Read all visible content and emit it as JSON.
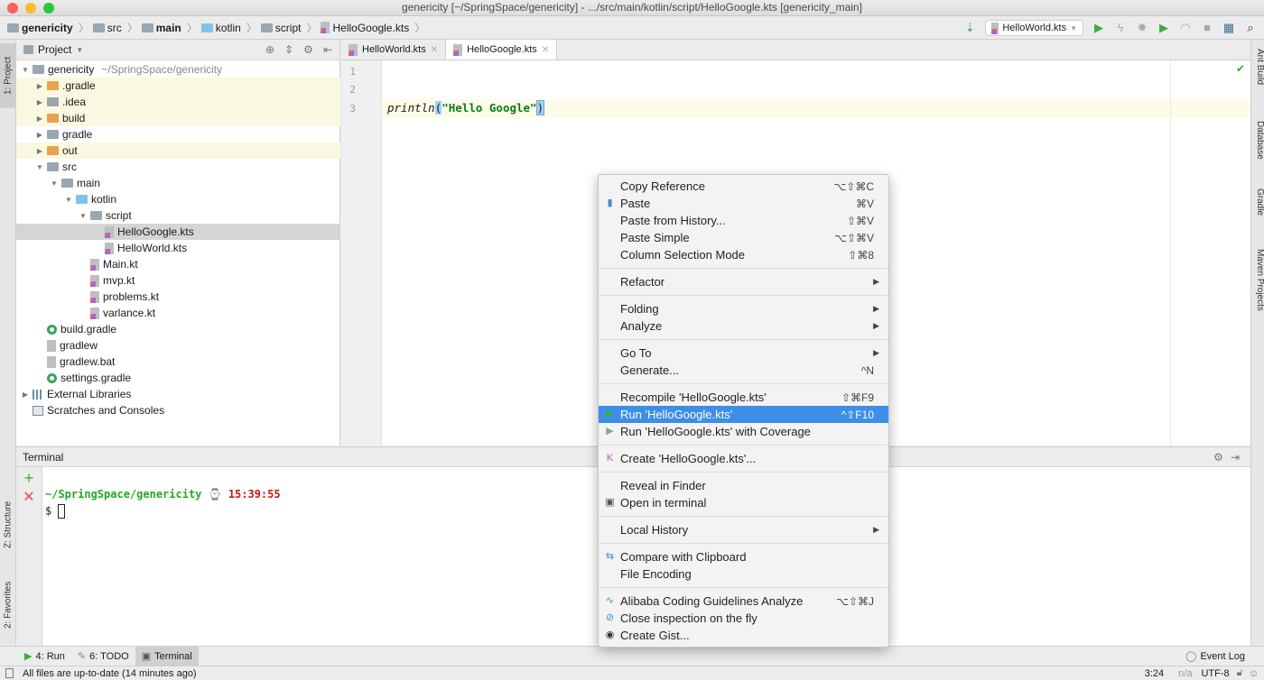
{
  "window": {
    "title": "genericity [~/SpringSpace/genericity] - .../src/main/kotlin/script/HelloGoogle.kts [genericity_main]"
  },
  "breadcrumb": [
    "genericity",
    "src",
    "main",
    "kotlin",
    "script",
    "HelloGoogle.kts"
  ],
  "toolbar": {
    "run_config": "HelloWorld.kts",
    "icons": [
      "build-icon",
      "run-icon",
      "debug-lightning-icon",
      "debug-icon",
      "coverage-icon",
      "profile-icon",
      "stop-icon",
      "project-structure-icon",
      "search-icon"
    ]
  },
  "left_stripe": {
    "project": "1: Project",
    "structure": "Z: Structure",
    "favorites": "2: Favorites"
  },
  "right_stripe": [
    "Ant Build",
    "Database",
    "Gradle",
    "Maven Projects"
  ],
  "project": {
    "header": "Project",
    "tree": [
      {
        "label": "genericity",
        "hint": "~/SpringSpace/genericity",
        "depth": 0,
        "icon": "module",
        "arrow": "down"
      },
      {
        "label": ".gradle",
        "depth": 1,
        "icon": "folder-orange",
        "arrow": "right",
        "excluded": true
      },
      {
        "label": ".idea",
        "depth": 1,
        "icon": "folder",
        "arrow": "right",
        "excluded": true
      },
      {
        "label": "build",
        "depth": 1,
        "icon": "folder-orange",
        "arrow": "right",
        "excluded": true
      },
      {
        "label": "gradle",
        "depth": 1,
        "icon": "folder",
        "arrow": "right"
      },
      {
        "label": "out",
        "depth": 1,
        "icon": "folder-orange",
        "arrow": "right",
        "excluded": true
      },
      {
        "label": "src",
        "depth": 1,
        "icon": "folder",
        "arrow": "down"
      },
      {
        "label": "main",
        "depth": 2,
        "icon": "folder",
        "arrow": "down"
      },
      {
        "label": "kotlin",
        "depth": 3,
        "icon": "folder-blue",
        "arrow": "down"
      },
      {
        "label": "script",
        "depth": 4,
        "icon": "folder",
        "arrow": "down"
      },
      {
        "label": "HelloGoogle.kts",
        "depth": 5,
        "icon": "kotlin-file",
        "selected": true
      },
      {
        "label": "HelloWorld.kts",
        "depth": 5,
        "icon": "kotlin-file"
      },
      {
        "label": "Main.kt",
        "depth": 4,
        "icon": "kotlin-file"
      },
      {
        "label": "mvp.kt",
        "depth": 4,
        "icon": "kotlin-file"
      },
      {
        "label": "problems.kt",
        "depth": 4,
        "icon": "kotlin-file"
      },
      {
        "label": "varlance.kt",
        "depth": 4,
        "icon": "kotlin-file"
      },
      {
        "label": "build.gradle",
        "depth": 1,
        "icon": "gradle"
      },
      {
        "label": "gradlew",
        "depth": 1,
        "icon": "file"
      },
      {
        "label": "gradlew.bat",
        "depth": 1,
        "icon": "file"
      },
      {
        "label": "settings.gradle",
        "depth": 1,
        "icon": "gradle"
      },
      {
        "label": "External Libraries",
        "depth": 0,
        "icon": "library",
        "arrow": "right"
      },
      {
        "label": "Scratches and Consoles",
        "depth": 0,
        "icon": "scratch"
      }
    ]
  },
  "editor": {
    "tabs": [
      {
        "label": "HelloWorld.kts",
        "active": false
      },
      {
        "label": "HelloGoogle.kts",
        "active": true
      }
    ],
    "line_numbers": [
      "1",
      "2",
      "3"
    ],
    "code": {
      "fn": "println",
      "open": "(",
      "str": "\"Hello Google\"",
      "close": ")"
    }
  },
  "terminal": {
    "title": "Terminal",
    "path": "~/SpringSpace/genericity",
    "time": "15:39:55",
    "prompt": "$"
  },
  "context_menu": [
    {
      "label": "Copy Reference",
      "shortcut": "⌥⇧⌘C"
    },
    {
      "label": "Paste",
      "shortcut": "⌘V",
      "icon": "paste-icon"
    },
    {
      "label": "Paste from History...",
      "shortcut": "⇧⌘V"
    },
    {
      "label": "Paste Simple",
      "shortcut": "⌥⇧⌘V"
    },
    {
      "label": "Column Selection Mode",
      "shortcut": "⇧⌘8"
    },
    {
      "separator": true
    },
    {
      "label": "Refactor",
      "submenu": true
    },
    {
      "separator": true
    },
    {
      "label": "Folding",
      "submenu": true
    },
    {
      "label": "Analyze",
      "submenu": true
    },
    {
      "separator": true
    },
    {
      "label": "Go To",
      "submenu": true
    },
    {
      "label": "Generate...",
      "shortcut": "^N"
    },
    {
      "separator": true
    },
    {
      "label": "Recompile 'HelloGoogle.kts'",
      "shortcut": "⇧⌘F9"
    },
    {
      "label": "Run 'HelloGoogle.kts'",
      "shortcut": "^⇧F10",
      "icon": "run-icon",
      "highlighted": true
    },
    {
      "label": "Run 'HelloGoogle.kts' with Coverage",
      "icon": "coverage-icon"
    },
    {
      "separator": true
    },
    {
      "label": "Create 'HelloGoogle.kts'...",
      "icon": "kotlin-icon"
    },
    {
      "separator": true
    },
    {
      "label": "Reveal in Finder"
    },
    {
      "label": "Open in terminal",
      "icon": "terminal-icon"
    },
    {
      "separator": true
    },
    {
      "label": "Local History",
      "submenu": true
    },
    {
      "separator": true
    },
    {
      "label": "Compare with Clipboard",
      "icon": "compare-icon"
    },
    {
      "label": "File Encoding"
    },
    {
      "separator": true
    },
    {
      "label": "Alibaba Coding Guidelines Analyze",
      "shortcut": "⌥⇧⌘J",
      "icon": "alibaba-icon"
    },
    {
      "label": "Close inspection on the fly",
      "icon": "inspection-off-icon"
    },
    {
      "label": "Create Gist...",
      "icon": "github-icon"
    }
  ],
  "bottom_tabs": [
    {
      "label": "4: Run",
      "icon": "run-icon"
    },
    {
      "label": "6: TODO",
      "icon": "todo-icon"
    },
    {
      "label": "Terminal",
      "icon": "terminal-icon",
      "active": true
    }
  ],
  "event_log": "Event Log",
  "status": {
    "message": "All files are up-to-date (14 minutes ago)",
    "position": "3:24",
    "na": "n/a",
    "encoding": "UTF-8"
  },
  "colors": {
    "accent": "#3d8ee6",
    "terminal_path": "#22a822",
    "terminal_time": "#c41a16",
    "run_green": "#3bac3b"
  }
}
